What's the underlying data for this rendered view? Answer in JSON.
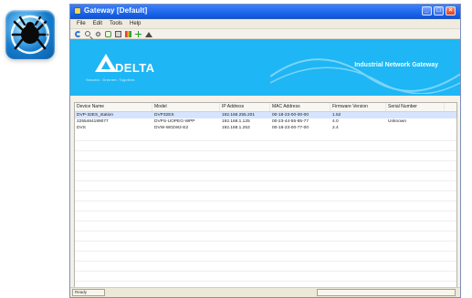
{
  "window": {
    "title": "Gateway [Default]"
  },
  "menu": {
    "items": [
      "File",
      "Edit",
      "Tools",
      "Help"
    ]
  },
  "banner": {
    "brand_name": "DELTA",
    "tagline": "Smarter. Greener. Together.",
    "title": "Industrial Network Gateway"
  },
  "table": {
    "headers": [
      "Device Name",
      "Model",
      "IP Address",
      "MAC Address",
      "Firmware Version",
      "Serial Number"
    ],
    "rows": [
      [
        "DVP-32ES_station",
        "DVP32ES",
        "192.168.255.201",
        "00-18-23-00-00-00",
        "1.52",
        ""
      ],
      [
        "2255464189077",
        "DVPS-UOPEG-WPP",
        "192.168.1.125",
        "00-23-44-55-85-77",
        "4.0",
        "Unknown"
      ],
      [
        "DVS",
        "DVW-W02W2-E2",
        "192.168.1.253",
        "00-18-23-00-77-00",
        "2.4",
        ""
      ]
    ]
  },
  "status": {
    "left": "Ready"
  },
  "icons": {
    "app_badge": "spider-icon",
    "toolbar": [
      "refresh-icon",
      "search-icon",
      "settings-icon",
      "link-icon",
      "device-icon",
      "color-icon",
      "add-icon",
      "up-icon"
    ]
  },
  "colors": {
    "banner_blue": "#1eb6f4",
    "titlebar_blue": "#0b55da"
  }
}
